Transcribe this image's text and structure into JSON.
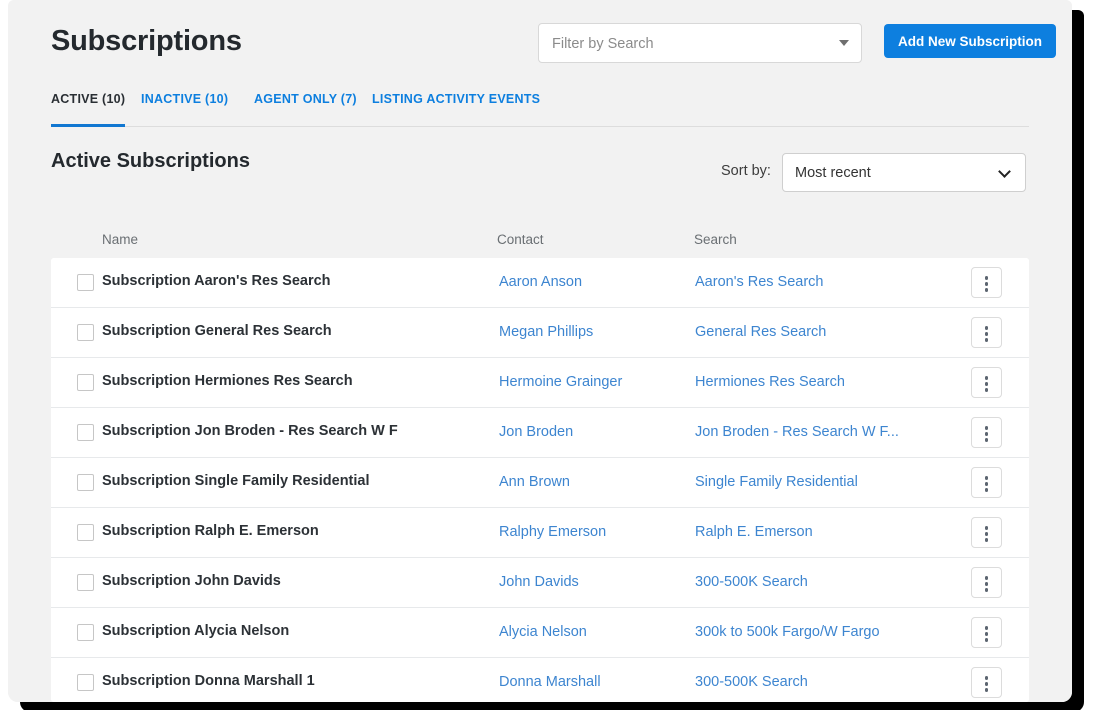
{
  "header": {
    "title": "Subscriptions",
    "search_placeholder": "Filter by Search",
    "search_value": "",
    "add_button_label": "Add New Subscription",
    "accent_color": "#0d7fdf"
  },
  "tabs": [
    {
      "label": "ACTIVE (10)",
      "active": true
    },
    {
      "label": "INACTIVE (10)",
      "active": false
    },
    {
      "label": "AGENT ONLY (7)",
      "active": false
    },
    {
      "label": "LISTING ACTIVITY EVENTS",
      "active": false
    }
  ],
  "section": {
    "heading": "Active Subscriptions",
    "sort_label": "Sort by:",
    "sort_value": "Most recent",
    "sort_options": [
      "Most recent"
    ]
  },
  "table": {
    "columns": [
      "Name",
      "Contact",
      "Search"
    ],
    "rows": [
      {
        "name": "Subscription Aaron's Res Search",
        "contact": "Aaron Anson",
        "search": "Aaron's Res Search"
      },
      {
        "name": "Subscription General Res Search",
        "contact": "Megan Phillips",
        "search": "General Res Search"
      },
      {
        "name": "Subscription Hermiones Res Search",
        "contact": "Hermoine Grainger",
        "search": "Hermiones Res Search"
      },
      {
        "name": "Subscription Jon Broden - Res Search W F",
        "contact": "Jon Broden",
        "search": "Jon Broden - Res Search W F..."
      },
      {
        "name": "Subscription Single Family Residential",
        "contact": "Ann Brown",
        "search": "Single Family Residential"
      },
      {
        "name": "Subscription Ralph E. Emerson",
        "contact": "Ralphy Emerson",
        "search": "Ralph E. Emerson"
      },
      {
        "name": "Subscription John Davids",
        "contact": "John Davids",
        "search": "300-500K Search"
      },
      {
        "name": "Subscription Alycia Nelson",
        "contact": "Alycia Nelson",
        "search": "300k to 500k Fargo/W Fargo"
      },
      {
        "name": "Subscription Donna Marshall 1",
        "contact": "Donna Marshall",
        "search": "300-500K Search"
      }
    ]
  }
}
